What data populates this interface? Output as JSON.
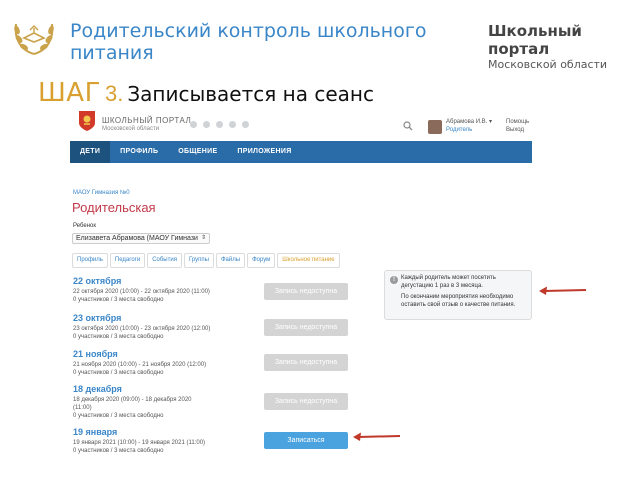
{
  "slide": {
    "title": "Родительский контроль школьного питания",
    "brand_main": "Школьный портал",
    "brand_sub": "Московской области",
    "step_word": "ШАГ",
    "step_number": "3.",
    "step_text": "Записывается на сеанс"
  },
  "portal": {
    "name": "ШКОЛЬНЫЙ ПОРТАЛ",
    "region": "Московской области",
    "user_name": "Абрамова И.В. ▾",
    "user_role": "Родитель",
    "help": "Помощь",
    "exit": "Выход",
    "nav": [
      "ДЕТИ",
      "ПРОФИЛЬ",
      "ОБЩЕНИЕ",
      "ПРИЛОЖЕНИЯ"
    ],
    "nav_active_index": 0
  },
  "page": {
    "breadcrumb": "МАОУ Гимназия №0",
    "heading": "Родительская",
    "child_label": "Ребенок",
    "child_value": "Елизавета Абрамова (МАОУ Гимнази",
    "tabs": [
      "Профиль",
      "Педагоги",
      "События",
      "Группы",
      "Файлы",
      "Форум",
      "Школьное питание"
    ],
    "active_tab_index": 6
  },
  "events": [
    {
      "date": "22 октября",
      "time": "22 октября 2020 (10:00) - 22 октября 2020 (11:00)",
      "seats": "0 участников / 3 места свободно",
      "button": "Запись недоступна",
      "available": false
    },
    {
      "date": "23 октября",
      "time": "23 октября 2020 (10:00) - 23 октября 2020 (12:00)",
      "seats": "0 участников / 3 места свободно",
      "button": "Запись недоступна",
      "available": false
    },
    {
      "date": "21 ноября",
      "time": "21 ноября 2020 (10:00) - 21 ноября 2020 (12:00)",
      "seats": "0 участников / 3 места свободно",
      "button": "Запись недоступна",
      "available": false
    },
    {
      "date": "18 декабря",
      "time_line1": "18 декабря 2020 (09:00) - 18 декабря 2020",
      "time_line2": "(11:00)",
      "seats": "0 участников / 3 места свободно",
      "button": "Запись недоступна",
      "available": false
    },
    {
      "date": "19 января",
      "time": "19 января 2021 (10:00) - 19 января 2021 (11:00)",
      "seats": "0 участников / 3 места свободно",
      "button": "Записаться",
      "available": true
    }
  ],
  "info": {
    "p1": "Каждый родитель может посетить дегустацию 1 раз в 3 месяца.",
    "p2": "По окончании мероприятия необходимо оставить свой отзыв о качестве питания."
  },
  "colors": {
    "accent_blue": "#3a86c8",
    "nav_bar": "#2a6ca8",
    "step_gold": "#d9a030",
    "heading_red": "#c23a4a",
    "arrow_red": "#c0392b",
    "button_enabled": "#4aa3df",
    "button_disabled": "#d4d4d4"
  },
  "icons": [
    "laurel-logo-icon",
    "moscow-region-crest-icon",
    "search-icon",
    "info-icon",
    "pointer-arrow-icon"
  ]
}
